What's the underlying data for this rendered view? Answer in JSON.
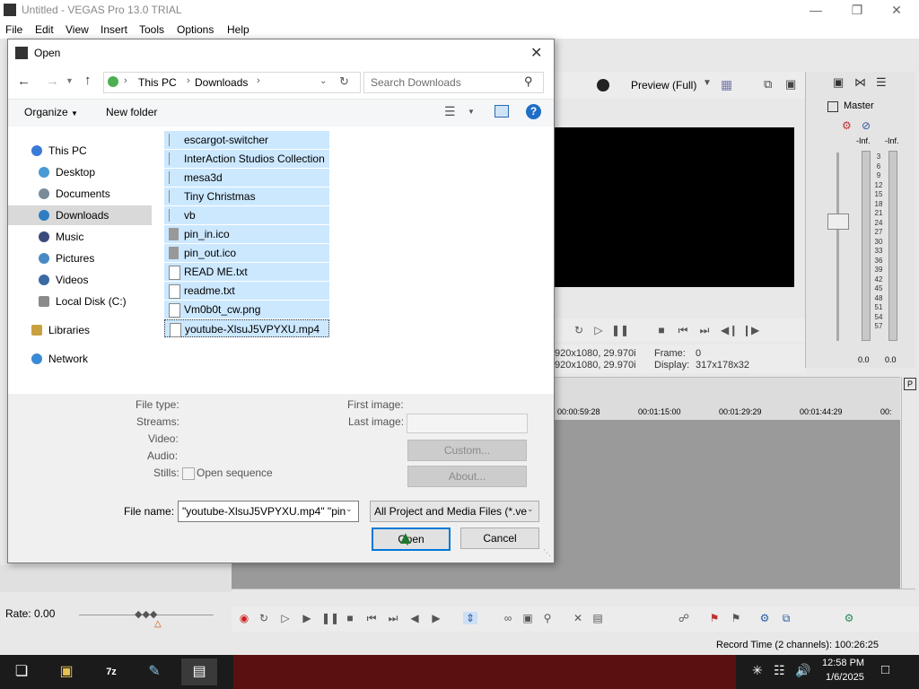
{
  "vegas": {
    "title": "Untitled - VEGAS Pro 13.0 TRIAL",
    "menu": [
      "File",
      "Edit",
      "View",
      "Insert",
      "Tools",
      "Options",
      "Help"
    ],
    "preview_mode": "Preview (Full)",
    "master_label": "Master",
    "meter_left_top": "-Inf.",
    "meter_right_top": "-Inf.",
    "meter_scale": [
      "3",
      "6",
      "9",
      "12",
      "15",
      "18",
      "21",
      "24",
      "27",
      "30",
      "33",
      "36",
      "39",
      "42",
      "45",
      "48",
      "51",
      "54",
      "57"
    ],
    "meter_left_bottom": "0.0",
    "meter_right_bottom": "0.0",
    "project_line1": "920x1080, 29.970i",
    "project_line2": "920x1080, 29.970i",
    "frame_label": "Frame:",
    "frame_value": "0",
    "display_label": "Display:",
    "display_value": "317x178x32",
    "ruler": [
      "00:00:59:28",
      "00:01:15:00",
      "00:01:29:29",
      "00:01:44:29",
      "00:"
    ],
    "rate_label": "Rate: 0.00",
    "record_time": "Record Time (2 channels): 100:26:25"
  },
  "dialog": {
    "title": "Open",
    "breadcrumb": [
      "This PC",
      "Downloads"
    ],
    "search_placeholder": "Search Downloads",
    "organize_label": "Organize",
    "new_folder_label": "New folder",
    "nav_items": [
      {
        "label": "This PC",
        "color": "#3a7bd5"
      },
      {
        "label": "Desktop",
        "color": "#4a9ad4"
      },
      {
        "label": "Documents",
        "color": "#7a8a99"
      },
      {
        "label": "Downloads",
        "color": "#2f7ec4"
      },
      {
        "label": "Music",
        "color": "#3a4a7a"
      },
      {
        "label": "Pictures",
        "color": "#4a8ac4"
      },
      {
        "label": "Videos",
        "color": "#3a6aa4"
      },
      {
        "label": "Local Disk (C:)",
        "color": "#8a8a8a"
      },
      {
        "label": "Libraries",
        "color": "#c8a040"
      },
      {
        "label": "Network",
        "color": "#3a8ad4"
      }
    ],
    "files": [
      {
        "name": "escargot-switcher",
        "icon": "folder-icon"
      },
      {
        "name": "InterAction Studios Collection",
        "icon": "folder-icon"
      },
      {
        "name": "mesa3d",
        "icon": "folder-icon"
      },
      {
        "name": "Tiny Christmas",
        "icon": "folder-icon"
      },
      {
        "name": "vb",
        "icon": "folder-icon"
      },
      {
        "name": "pin_in.ico",
        "icon": "ico-file-icon"
      },
      {
        "name": "pin_out.ico",
        "icon": "ico-file-icon"
      },
      {
        "name": "READ ME.txt",
        "icon": "text-file-icon"
      },
      {
        "name": "readme.txt",
        "icon": "text-file-icon"
      },
      {
        "name": "Vm0b0t_cw.png",
        "icon": "image-file-icon"
      },
      {
        "name": "youtube-XlsuJ5VPYXU.mp4",
        "icon": "video-file-icon"
      }
    ],
    "info_labels": {
      "file_type": "File type:",
      "streams": "Streams:",
      "video": "Video:",
      "audio": "Audio:",
      "stills": "Stills:",
      "open_sequence": "Open sequence",
      "first_image": "First image:",
      "last_image": "Last image:",
      "custom": "Custom...",
      "about": "About..."
    },
    "file_name_label": "File name:",
    "file_name_value": "\"youtube-XlsuJ5VPYXU.mp4\" \"pin",
    "file_type_value": "All Project and Media Files (*.ve",
    "open_label": "Open",
    "cancel_label": "Cancel"
  },
  "taskbar": {
    "time": "12:58 PM",
    "date": "1/6/2025"
  }
}
